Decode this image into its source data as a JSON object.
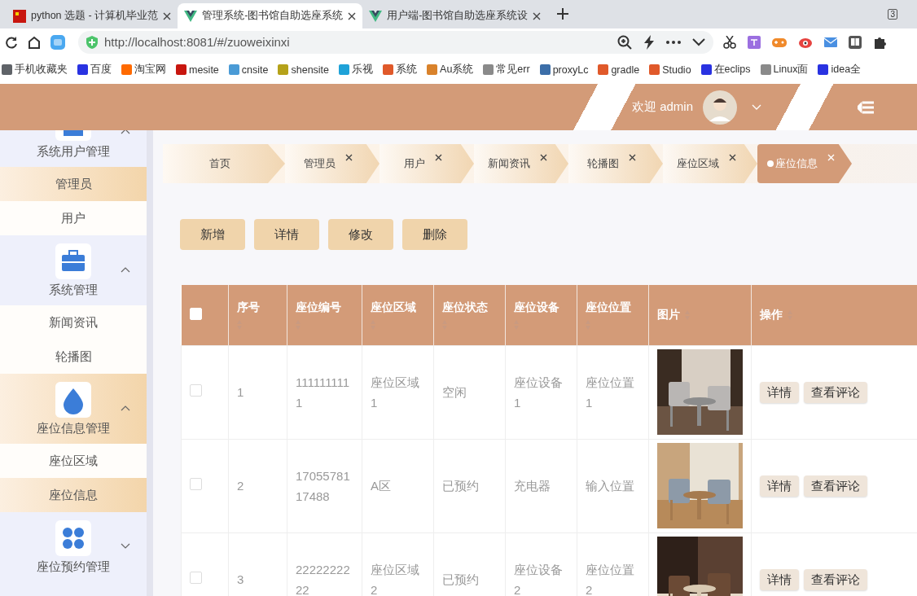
{
  "browser": {
    "tabs": [
      {
        "title": "python 选题 - 计算机毕业范",
        "kind": "flag",
        "selected": false
      },
      {
        "title": "管理系统-图书馆自助选座系统",
        "kind": "vue",
        "selected": true
      },
      {
        "title": "用户端-图书馆自助选座系统设",
        "kind": "vue",
        "selected": false
      }
    ],
    "tab_count": "3",
    "address": "http://localhost:8081/#/zuoweixinxi",
    "bookmarks": [
      {
        "label": "手机收藏夹",
        "color": "#5f6368"
      },
      {
        "label": "百度",
        "color": "#2932e1"
      },
      {
        "label": "淘宝网",
        "color": "#ff6a00"
      },
      {
        "label": "mesite",
        "color": "#c8160f"
      },
      {
        "label": "cnsite",
        "color": "#4a9bd6"
      },
      {
        "label": "shensite",
        "color": "#b5a21a"
      },
      {
        "label": "乐视",
        "color": "#1fa2d8"
      },
      {
        "label": "系统",
        "color": "#e0592a"
      },
      {
        "label": "Au系统",
        "color": "#d9822b"
      },
      {
        "label": "常见err",
        "color": "#8a8a8a"
      },
      {
        "label": "proxyLc",
        "color": "#3c6ea8"
      },
      {
        "label": "gradle",
        "color": "#e0592a"
      },
      {
        "label": "Studio",
        "color": "#e0592a"
      },
      {
        "label": "在eclips",
        "color": "#2932e1"
      },
      {
        "label": "Linux面",
        "color": "#8a8a8a"
      },
      {
        "label": "idea全",
        "color": "#2932e1"
      }
    ]
  },
  "header": {
    "welcome": "欢迎 admin"
  },
  "sidebar": {
    "groups": [
      {
        "label": "系统用户管理",
        "expanded": true,
        "selected": false,
        "children": [
          {
            "label": "管理员",
            "selected": true
          },
          {
            "label": "用户",
            "selected": false
          }
        ]
      },
      {
        "label": "系统管理",
        "expanded": true,
        "selected": false,
        "children": [
          {
            "label": "新闻资讯",
            "selected": false
          },
          {
            "label": "轮播图",
            "selected": false
          }
        ]
      },
      {
        "label": "座位信息管理",
        "expanded": true,
        "selected": true,
        "children": [
          {
            "label": "座位区域",
            "selected": false
          },
          {
            "label": "座位信息",
            "selected": true
          }
        ]
      },
      {
        "label": "座位预约管理",
        "expanded": false,
        "selected": false
      }
    ]
  },
  "breadcrumbs": [
    {
      "label": "首页",
      "closable": false,
      "selected": false
    },
    {
      "label": "管理员",
      "closable": true,
      "selected": false
    },
    {
      "label": "用户",
      "closable": true,
      "selected": false
    },
    {
      "label": "新闻资讯",
      "closable": true,
      "selected": false
    },
    {
      "label": "轮播图",
      "closable": true,
      "selected": false
    },
    {
      "label": "座位区域",
      "closable": true,
      "selected": false
    },
    {
      "label": "座位信息",
      "closable": true,
      "selected": true
    }
  ],
  "toolbar": [
    "新增",
    "详情",
    "修改",
    "删除"
  ],
  "table": {
    "select_all_checked": false,
    "columns": [
      "序号",
      "座位编号",
      "座位区域",
      "座位状态",
      "座位设备",
      "座位位置",
      "图片",
      "操作"
    ],
    "rows": [
      {
        "checked": false,
        "cells": [
          "1",
          "1111111111",
          "座位区域1",
          "空闲",
          "座位设备1",
          "座位位置1"
        ],
        "image": {
          "kind": "picture"
        },
        "actions": [
          "详情",
          "查看评论"
        ]
      },
      {
        "checked": false,
        "cells": [
          "2",
          "1705578117488",
          "A区",
          "已预约",
          "充电器",
          "输入位置"
        ],
        "image": {
          "kind": "picture"
        },
        "actions": [
          "详情",
          "查看评论"
        ]
      },
      {
        "checked": false,
        "cells": [
          "3",
          "2222222222",
          "座位区域2",
          "已预约",
          "座位设备2",
          "座位位置2"
        ],
        "image": {
          "kind": "picture"
        },
        "actions": [
          "详情",
          "查看评论"
        ]
      }
    ]
  }
}
